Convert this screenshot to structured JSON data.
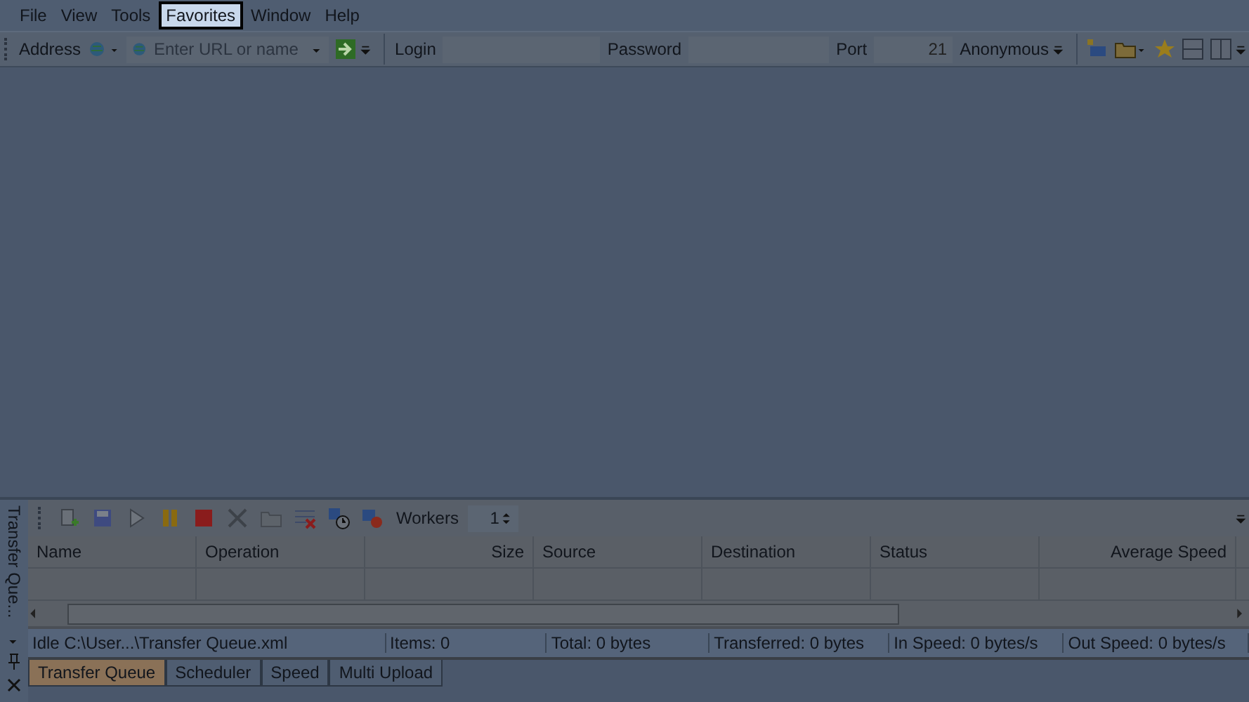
{
  "menu": [
    {
      "label": "File",
      "selected": false
    },
    {
      "label": "View",
      "selected": false
    },
    {
      "label": "Tools",
      "selected": false
    },
    {
      "label": "Favorites",
      "selected": true
    },
    {
      "label": "Window",
      "selected": false
    },
    {
      "label": "Help",
      "selected": false
    }
  ],
  "address_bar": {
    "label": "Address",
    "placeholder": "Enter URL or name",
    "login_label": "Login",
    "password_label": "Password",
    "port_label": "Port",
    "port": "21",
    "anonymous": "Anonymous"
  },
  "queue_panel": {
    "title": "Transfer Que...",
    "workers_label": "Workers",
    "workers": "1",
    "columns": [
      "Name",
      "Operation",
      "Size",
      "Source",
      "Destination",
      "Status",
      "Average Speed"
    ],
    "status_bar": [
      "Idle   C:\\User...\\Transfer Queue.xml",
      "Items: 0",
      "Total: 0 bytes",
      "Transferred: 0 bytes",
      "In Speed: 0 bytes/s",
      "Out Speed: 0 bytes/s"
    ],
    "tabs": [
      {
        "label": "Transfer Queue",
        "selected": true
      },
      {
        "label": "Scheduler",
        "selected": false
      },
      {
        "label": "Speed",
        "selected": false
      },
      {
        "label": "Multi Upload",
        "selected": false
      }
    ]
  }
}
